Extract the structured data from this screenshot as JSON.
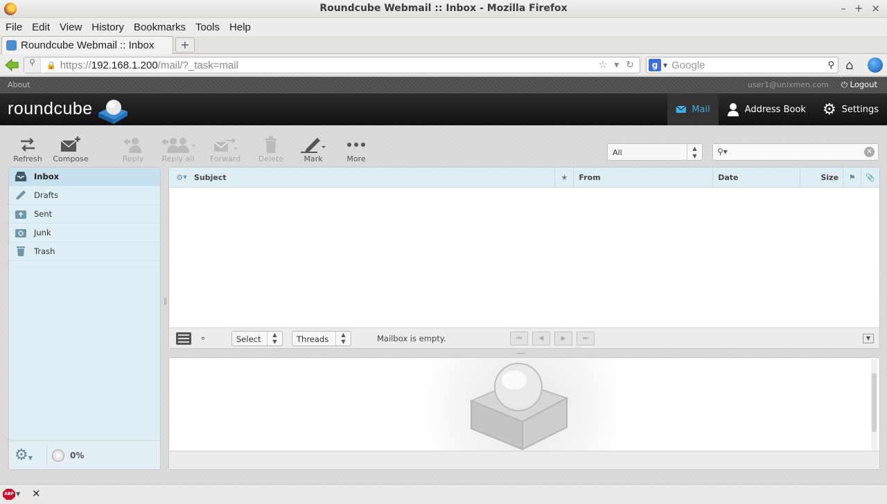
{
  "window": {
    "title": "Roundcube Webmail :: Inbox - Mozilla Firefox",
    "controls": [
      "–",
      "+",
      "×"
    ]
  },
  "menu": [
    "File",
    "Edit",
    "View",
    "History",
    "Bookmarks",
    "Tools",
    "Help"
  ],
  "tab": {
    "title": "Roundcube Webmail :: Inbox",
    "new_tab": "+"
  },
  "urlbar": {
    "url_scheme": "https://",
    "url_host": "192.168.1.200",
    "url_path": "/mail/?_task=mail"
  },
  "searchbar": {
    "engine": "g",
    "placeholder": "Google"
  },
  "topline": {
    "about": "About",
    "user": "user1@unixmen.com",
    "logout": "Logout"
  },
  "brand": {
    "logo": "roundcube"
  },
  "tasks": {
    "mail": "Mail",
    "addressbook": "Address Book",
    "settings": "Settings"
  },
  "toolbar": {
    "refresh": "Refresh",
    "compose": "Compose",
    "reply": "Reply",
    "reply_all": "Reply all",
    "forward": "Forward",
    "delete": "Delete",
    "mark": "Mark",
    "more": "More"
  },
  "filter": {
    "selected": "All"
  },
  "folders": [
    {
      "name": "Inbox",
      "icon": "inbox-icon"
    },
    {
      "name": "Drafts",
      "icon": "pencil-icon"
    },
    {
      "name": "Sent",
      "icon": "sent-icon"
    },
    {
      "name": "Junk",
      "icon": "junk-icon"
    },
    {
      "name": "Trash",
      "icon": "trash-icon"
    }
  ],
  "quota": {
    "text": "0%"
  },
  "list": {
    "columns": {
      "subject": "Subject",
      "from": "From",
      "date": "Date",
      "size": "Size"
    },
    "footer": {
      "select": "Select",
      "threads": "Threads",
      "status": "Mailbox is empty."
    }
  },
  "colors": {
    "accent": "#3cb0e7",
    "panel": "#ddeef5",
    "header_bg": "#1d1d1d"
  }
}
